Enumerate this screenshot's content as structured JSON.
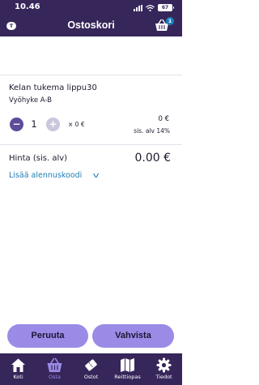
{
  "status": {
    "time": "10.46",
    "battery": "67"
  },
  "header": {
    "title": "Ostoskori",
    "lang": "T",
    "cart_count": "1"
  },
  "item": {
    "title": "Kelan tukema lippu30",
    "zone": "Vyöhyke A-B",
    "quantity": "1",
    "minus": "−",
    "plus": "+",
    "unit_price": "× 0 €",
    "line_total": "0 €",
    "vat": "sis. alv 14%"
  },
  "total": {
    "label": "Hinta  (sis. alv)",
    "value": "0.00 €"
  },
  "discount": {
    "label": "Lisää alennuskoodi",
    "chevron": "v"
  },
  "actions": {
    "cancel": "Peruuta",
    "confirm": "Vahvista"
  },
  "tabs": [
    {
      "label": "Koti",
      "icon": "home-icon"
    },
    {
      "label": "Osta",
      "icon": "basket-icon"
    },
    {
      "label": "Ostot",
      "icon": "ticket-icon"
    },
    {
      "label": "Reittiopas",
      "icon": "map-icon"
    },
    {
      "label": "Tiedot",
      "icon": "gear-icon"
    }
  ],
  "colors": {
    "header_bg": "#36265a",
    "accent": "#9b8be6",
    "active_tab": "#9b8be6",
    "link": "#1f7db1",
    "badge": "#1b7fbd"
  }
}
